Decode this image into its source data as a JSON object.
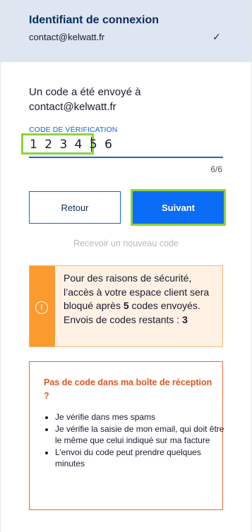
{
  "identity": {
    "title": "Identifiant de connexion",
    "email": "contact@kelwatt.fr",
    "check_glyph": "✓"
  },
  "intro": {
    "text": "Un code a été envoyé à contact@kelwatt.fr"
  },
  "code_field": {
    "label": "CODE DE VÉRIFICATION",
    "value": "123456",
    "counter": "6/6"
  },
  "buttons": {
    "back_label": "Retour",
    "next_label": "Suivant",
    "resend_label": "Recevoir un nouveau code"
  },
  "warning": {
    "icon": "info-circle-icon",
    "line1": "Pour des raisons de sécurité, l’accès à votre espace client sera bloqué après ",
    "line1_bold": "5",
    "line1_end": " codes envoyés.",
    "line2": "Envois de codes restants : ",
    "line2_bold": "3",
    "colors": {
      "side": "#fb9a2e",
      "bg": "#fff1e3"
    }
  },
  "help": {
    "title": "Pas de code dans ma boîte de réception ?",
    "items": [
      "Je vérifie dans mes spams",
      "Je vérifie la saisie de mon email, qui doit être le même que celui indiqué sur ma facture",
      "L’envoi du code peut prendre quelques minutes"
    ]
  },
  "colors": {
    "accent_blue": "#0b6cf5",
    "highlight_green": "#8cd43a",
    "help_orange": "#e0561f"
  }
}
